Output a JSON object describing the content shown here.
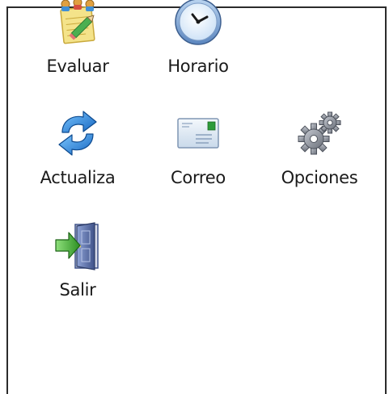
{
  "launcher": {
    "items": [
      {
        "label": "Evaluar",
        "icon": "evaluate-icon"
      },
      {
        "label": "Horario",
        "icon": "clock-icon"
      },
      {
        "label": "Actualiza",
        "icon": "refresh-icon"
      },
      {
        "label": "Correo",
        "icon": "mail-icon"
      },
      {
        "label": "Opciones",
        "icon": "gears-icon"
      },
      {
        "label": "Salir",
        "icon": "exit-door-icon"
      }
    ]
  },
  "colors": {
    "border": "#2b2b2b",
    "background": "#ffffff",
    "refresh_blue": "#1e88d6",
    "exit_green": "#3caa2c",
    "door_blue": "#5b6fa3",
    "gear_gray": "#8a8f99"
  }
}
